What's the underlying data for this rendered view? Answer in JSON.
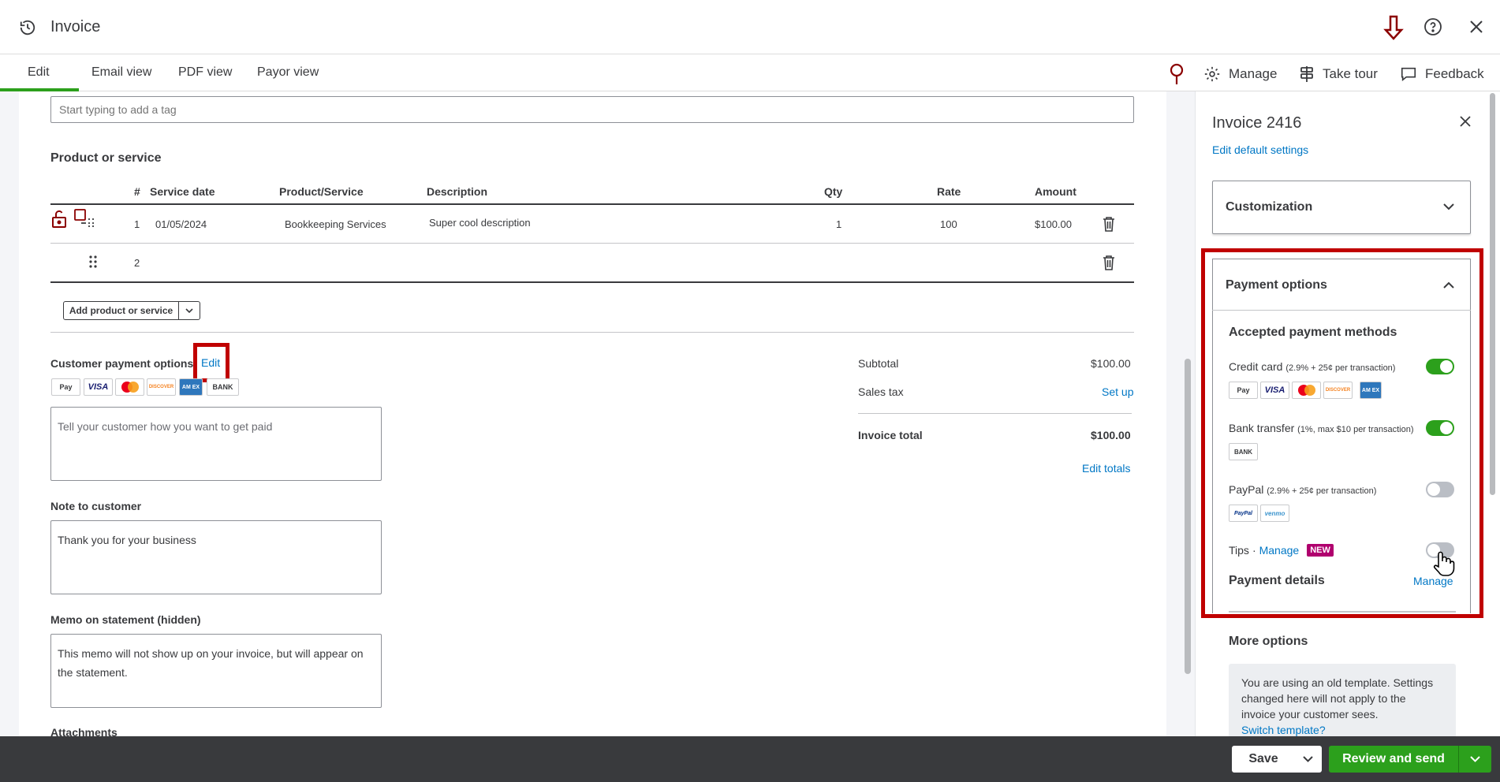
{
  "header": {
    "title": "Invoice"
  },
  "tabs": [
    "Edit",
    "Email view",
    "PDF view",
    "Payor view"
  ],
  "tools": {
    "manage": "Manage",
    "take_tour": "Take tour",
    "feedback": "Feedback"
  },
  "form": {
    "tag_placeholder": "Start typing to add a tag",
    "section_title": "Product or service",
    "columns": {
      "num": "#",
      "service_date": "Service date",
      "product": "Product/Service",
      "description": "Description",
      "qty": "Qty",
      "rate": "Rate",
      "amount": "Amount"
    },
    "rows": [
      {
        "num": "1",
        "service_date": "01/05/2024",
        "product": "Bookkeeping Services",
        "description": "Super cool description",
        "qty": "1",
        "rate": "100",
        "amount": "$100.00"
      },
      {
        "num": "2",
        "service_date": "",
        "product": "",
        "description": "",
        "qty": "",
        "rate": "",
        "amount": ""
      }
    ],
    "add_button": "Add product or service",
    "payment_options_label": "Customer payment options",
    "edit_link": "Edit",
    "payment_placeholder": "Tell your customer how you want to get paid",
    "note_label": "Note to customer",
    "note_value": "Thank you for your business",
    "memo_label": "Memo on statement (hidden)",
    "memo_value": "This memo will not show up on your invoice, but will appear on the statement.",
    "attachments_label": "Attachments"
  },
  "totals": {
    "subtotal_label": "Subtotal",
    "subtotal_value": "$100.00",
    "tax_label": "Sales tax",
    "tax_link": "Set up",
    "total_label": "Invoice total",
    "total_value": "$100.00",
    "edit_totals": "Edit totals"
  },
  "cards": {
    "apple": "Pay",
    "visa": "VISA",
    "discover": "DISCOVER",
    "amex": "AM EX",
    "bank": "BANK",
    "paypal": "PayPal",
    "venmo": "venmo"
  },
  "panel": {
    "title": "Invoice 2416",
    "edit_defaults": "Edit default settings",
    "customization": "Customization",
    "payment_options": "Payment options",
    "accepted_methods": "Accepted payment methods",
    "credit_card": {
      "name": "Credit card",
      "fee": "(2.9% + 25¢ per transaction)",
      "enabled": true
    },
    "bank_transfer": {
      "name": "Bank transfer",
      "fee": "(1%, max $10 per transaction)",
      "enabled": true
    },
    "paypal": {
      "name": "PayPal",
      "fee": "(2.9% + 25¢ per transaction)",
      "enabled": false
    },
    "tips": {
      "name": "Tips",
      "sep": "·",
      "manage": "Manage",
      "badge": "NEW",
      "enabled": false
    },
    "payment_details": "Payment details",
    "payment_details_manage": "Manage",
    "more_options": "More options",
    "notice": "You are using an old template. Settings changed here will not apply to the invoice your customer sees.",
    "switch_template": "Switch template?"
  },
  "footer": {
    "save": "Save",
    "review_send": "Review and send"
  },
  "colors": {
    "green": "#2ca01c",
    "link": "#0077c5",
    "highlight": "#c00000",
    "tips_badge": "#b0006e"
  }
}
